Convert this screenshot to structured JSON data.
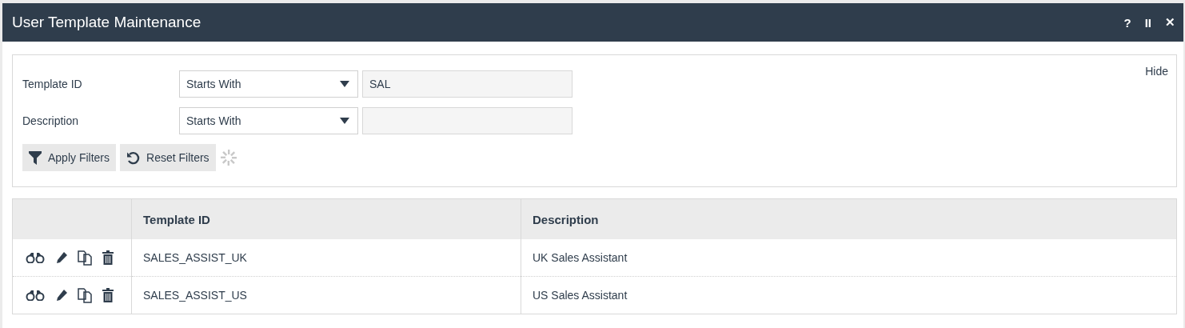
{
  "window": {
    "title": "User Template Maintenance",
    "controls": [
      "?",
      "II",
      "✕"
    ]
  },
  "filters": {
    "hide_link": "Hide",
    "rows": [
      {
        "label": "Template ID",
        "operator": "Starts With",
        "value": "SAL"
      },
      {
        "label": "Description",
        "operator": "Starts With",
        "value": ""
      }
    ],
    "buttons": [
      {
        "kind": "apply",
        "label": "Apply Filters"
      },
      {
        "kind": "reset",
        "label": "Reset Filters"
      }
    ],
    "loading": true
  },
  "table": {
    "columns": [
      "Template ID",
      "Description"
    ],
    "rows": [
      {
        "cells": [
          "SALES_ASSIST_UK",
          "UK Sales Assistant"
        ]
      },
      {
        "cells": [
          "SALES_ASSIST_US",
          "US Sales Assistant"
        ]
      }
    ]
  }
}
